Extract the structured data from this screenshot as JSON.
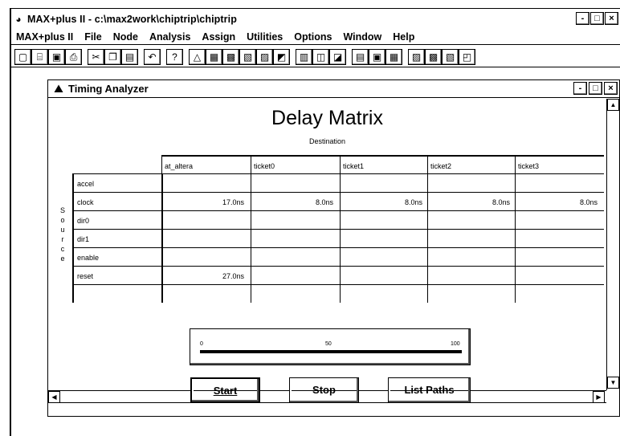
{
  "app": {
    "title": "MAX+plus II - c:\\max2work\\chiptrip\\chiptrip",
    "window_buttons": [
      "-",
      "□",
      "×"
    ]
  },
  "menu": [
    "MAX+plus II",
    "File",
    "Node",
    "Analysis",
    "Assign",
    "Utilities",
    "Options",
    "Window",
    "Help"
  ],
  "toolbar_groups": [
    [
      {
        "icon": "new-file-icon",
        "glyph": "▢"
      },
      {
        "icon": "open-icon",
        "glyph": "⌸"
      },
      {
        "icon": "save-icon",
        "glyph": "▣"
      },
      {
        "icon": "print-icon",
        "glyph": "⎙"
      }
    ],
    [
      {
        "icon": "cut-icon",
        "glyph": "✂"
      },
      {
        "icon": "copy-icon",
        "glyph": "❐"
      },
      {
        "icon": "paste-icon",
        "glyph": "▤"
      }
    ],
    [
      {
        "icon": "undo-icon",
        "glyph": "↶"
      }
    ],
    [
      {
        "icon": "help-icon",
        "glyph": "?"
      }
    ],
    [
      {
        "icon": "hierarchy-icon",
        "glyph": "△"
      },
      {
        "icon": "floorplan-icon",
        "glyph": "▦"
      },
      {
        "icon": "compiler-icon",
        "glyph": "▩"
      },
      {
        "icon": "simulator-icon",
        "glyph": "▧"
      },
      {
        "icon": "timing-icon",
        "glyph": "▨"
      },
      {
        "icon": "programmer-icon",
        "glyph": "◩"
      }
    ],
    [
      {
        "icon": "symbol-editor-icon",
        "glyph": "▥"
      },
      {
        "icon": "graphic-editor-icon",
        "glyph": "◫"
      },
      {
        "icon": "text-editor-icon",
        "glyph": "◪"
      }
    ],
    [
      {
        "icon": "waveform-icon",
        "glyph": "▤"
      },
      {
        "icon": "report-icon",
        "glyph": "▣"
      },
      {
        "icon": "message-icon",
        "glyph": "▦"
      }
    ],
    [
      {
        "icon": "assign-pin-icon",
        "glyph": "▨"
      },
      {
        "icon": "assign-device-icon",
        "glyph": "▩"
      },
      {
        "icon": "assign-clique-icon",
        "glyph": "▧"
      },
      {
        "icon": "assign-logic-icon",
        "glyph": "◰"
      }
    ]
  ],
  "timing_analyzer": {
    "title": "Timing Analyzer",
    "window_buttons": [
      "-",
      "□",
      "×"
    ],
    "matrix_title": "Delay Matrix",
    "destination_label": "Destination",
    "source_label": "Source",
    "columns": [
      "at_altera",
      "ticket0",
      "ticket1",
      "ticket2",
      "ticket3"
    ],
    "rows": [
      {
        "source": "accel",
        "values": [
          "",
          "",
          "",
          "",
          ""
        ]
      },
      {
        "source": "clock",
        "values": [
          "17.0ns",
          "8.0ns",
          "8.0ns",
          "8.0ns",
          "8.0ns"
        ]
      },
      {
        "source": "dir0",
        "values": [
          "",
          "",
          "",
          "",
          ""
        ]
      },
      {
        "source": "dir1",
        "values": [
          "",
          "",
          "",
          "",
          ""
        ]
      },
      {
        "source": "enable",
        "values": [
          "",
          "",
          "",
          "",
          ""
        ]
      },
      {
        "source": "reset",
        "values": [
          "27.0ns",
          "",
          "",
          "",
          ""
        ]
      },
      {
        "source": "",
        "values": [
          "",
          "",
          "",
          "",
          ""
        ]
      }
    ],
    "progress": {
      "percent": 100,
      "tick_labels": [
        "0",
        "50",
        "100"
      ]
    },
    "buttons": {
      "start": "Start",
      "stop": "Stop",
      "list_paths": "List Paths"
    }
  }
}
